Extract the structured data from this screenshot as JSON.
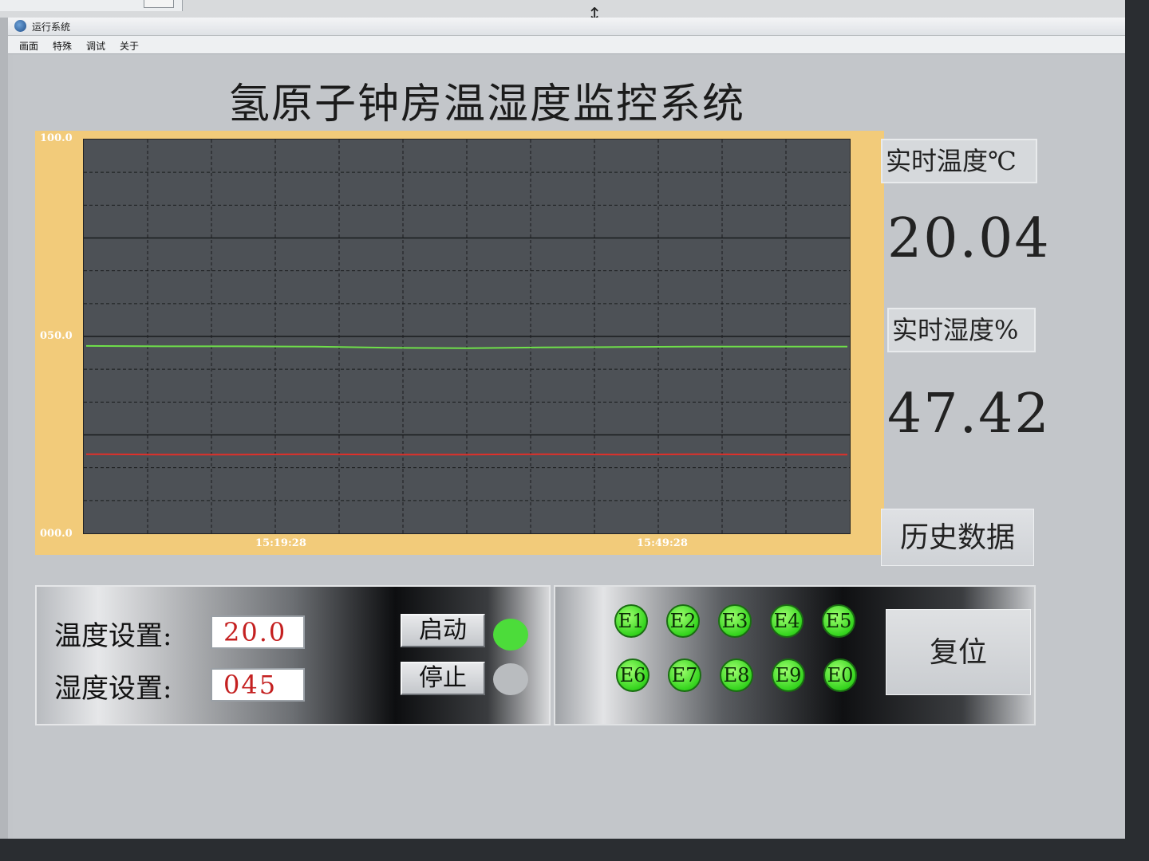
{
  "window": {
    "title": "运行系统"
  },
  "menu": [
    "画面",
    "特殊",
    "调试",
    "关于"
  ],
  "main_title": "氢原子钟房温湿度监控系统",
  "chart_data": {
    "type": "line",
    "title": "",
    "xlabel": "",
    "ylabel": "",
    "ylim": [
      0,
      100
    ],
    "yticks": [
      "000.0",
      "050.0",
      "100.0"
    ],
    "xticks": [
      "15:19:28",
      "15:49:28"
    ],
    "grid": true,
    "series": [
      {
        "color": "#6fe04a",
        "x": [
          0,
          10,
          20,
          30,
          40,
          50,
          60,
          70,
          80,
          90,
          100
        ],
        "values": [
          47.6,
          47.5,
          47.5,
          47.4,
          47.1,
          47.0,
          47.2,
          47.3,
          47.4,
          47.4,
          47.4
        ]
      },
      {
        "color": "#e0302a",
        "x": [
          0,
          10,
          20,
          30,
          40,
          50,
          60,
          70,
          80,
          90,
          100
        ],
        "values": [
          20.1,
          20.0,
          20.0,
          20.1,
          20.0,
          20.0,
          20.1,
          20.0,
          20.1,
          20.0,
          20.0
        ]
      }
    ]
  },
  "realtime": {
    "temp_label": "实时温度℃",
    "temp_value": "20.04",
    "humid_label": "实时湿度%",
    "humid_value": "47.42"
  },
  "history_button": "历史数据",
  "settings": {
    "temp_label": "温度设置:",
    "temp_value": "20.0",
    "humid_label": "湿度设置:",
    "humid_value": "045",
    "start_label": "启动",
    "stop_label": "停止",
    "start_lamp_color": "#4cdc3a",
    "stop_lamp_color": "#b9bcbf"
  },
  "alarms": [
    "E1",
    "E2",
    "E3",
    "E4",
    "E5",
    "E6",
    "E7",
    "E8",
    "E9",
    "E0"
  ],
  "reset_button": "复位",
  "colors": {
    "chart_frame": "#f2cb7a",
    "plot_bg": "#4d5156",
    "alarm_led": "#35d41e"
  }
}
